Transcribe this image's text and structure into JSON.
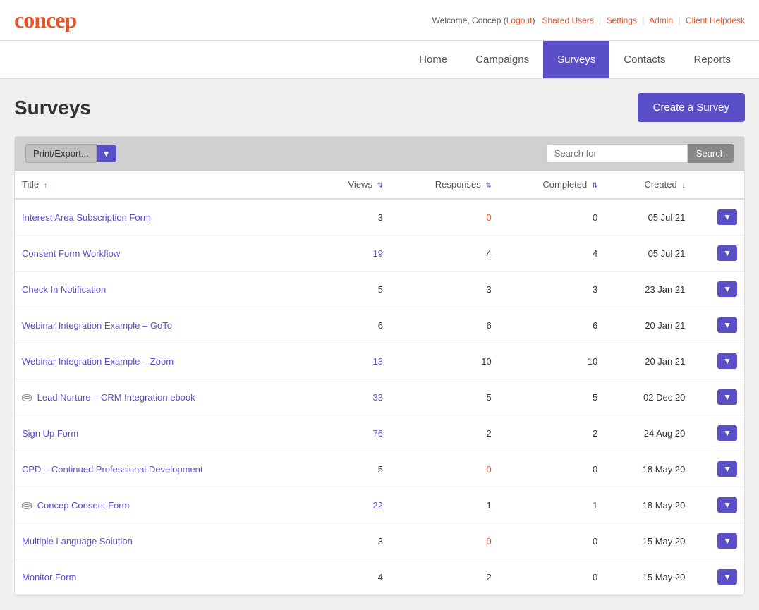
{
  "app": {
    "logo": "concep",
    "user": "Welcome, Concep",
    "logout_label": "Logout",
    "links": [
      "Shared Users",
      "Settings",
      "Admin",
      "Client Helpdesk"
    ]
  },
  "nav": {
    "items": [
      {
        "label": "Home",
        "active": false
      },
      {
        "label": "Campaigns",
        "active": false
      },
      {
        "label": "Surveys",
        "active": true
      },
      {
        "label": "Contacts",
        "active": false
      },
      {
        "label": "Reports",
        "active": false
      }
    ]
  },
  "page": {
    "title": "Surveys",
    "create_button": "Create a Survey"
  },
  "toolbar": {
    "print_export": "Print/Export...",
    "search_placeholder": "Search for",
    "search_button": "Search"
  },
  "table": {
    "columns": [
      {
        "label": "Title",
        "sort": "asc",
        "type": "text"
      },
      {
        "label": "Views",
        "sort": "both",
        "type": "num"
      },
      {
        "label": "Responses",
        "sort": "both",
        "type": "num"
      },
      {
        "label": "Completed",
        "sort": "both",
        "type": "num"
      },
      {
        "label": "Created",
        "sort": "desc",
        "type": "num"
      },
      {
        "label": "",
        "type": "action"
      }
    ],
    "rows": [
      {
        "title": "Interest Area Subscription Form",
        "views": "3",
        "responses": "0",
        "completed": "0",
        "created": "05 Jul 21",
        "views_blue": false,
        "responses_zero": true,
        "completed_zero": false,
        "icon": false
      },
      {
        "title": "Consent Form Workflow",
        "views": "19",
        "responses": "4",
        "completed": "4",
        "created": "05 Jul 21",
        "views_blue": true,
        "responses_zero": false,
        "completed_zero": false,
        "icon": false
      },
      {
        "title": "Check In Notification",
        "views": "5",
        "responses": "3",
        "completed": "3",
        "created": "23 Jan 21",
        "views_blue": false,
        "responses_zero": false,
        "completed_zero": false,
        "icon": false
      },
      {
        "title": "Webinar Integration Example – GoTo",
        "views": "6",
        "responses": "6",
        "completed": "6",
        "created": "20 Jan 21",
        "views_blue": false,
        "responses_zero": false,
        "completed_zero": false,
        "icon": false
      },
      {
        "title": "Webinar Integration Example – Zoom",
        "views": "13",
        "responses": "10",
        "completed": "10",
        "created": "20 Jan 21",
        "views_blue": true,
        "responses_zero": false,
        "completed_zero": false,
        "icon": false
      },
      {
        "title": "Lead Nurture – CRM Integration ebook",
        "views": "33",
        "responses": "5",
        "completed": "5",
        "created": "02 Dec 20",
        "views_blue": true,
        "responses_zero": false,
        "completed_zero": false,
        "icon": true
      },
      {
        "title": "Sign Up Form",
        "views": "76",
        "responses": "2",
        "completed": "2",
        "created": "24 Aug 20",
        "views_blue": true,
        "responses_zero": false,
        "completed_zero": false,
        "icon": false
      },
      {
        "title": "CPD – Continued Professional Development",
        "views": "5",
        "responses": "0",
        "completed": "0",
        "created": "18 May 20",
        "views_blue": false,
        "responses_zero": true,
        "completed_zero": false,
        "icon": false
      },
      {
        "title": "Concep Consent Form",
        "views": "22",
        "responses": "1",
        "completed": "1",
        "created": "18 May 20",
        "views_blue": true,
        "responses_zero": false,
        "completed_zero": false,
        "icon": true
      },
      {
        "title": "Multiple Language Solution",
        "views": "3",
        "responses": "0",
        "completed": "0",
        "created": "15 May 20",
        "views_blue": false,
        "responses_zero": true,
        "completed_zero": false,
        "icon": false
      },
      {
        "title": "Monitor Form",
        "views": "4",
        "responses": "2",
        "completed": "0",
        "created": "15 May 20",
        "views_blue": false,
        "responses_zero": false,
        "completed_zero": false,
        "icon": false
      }
    ]
  }
}
